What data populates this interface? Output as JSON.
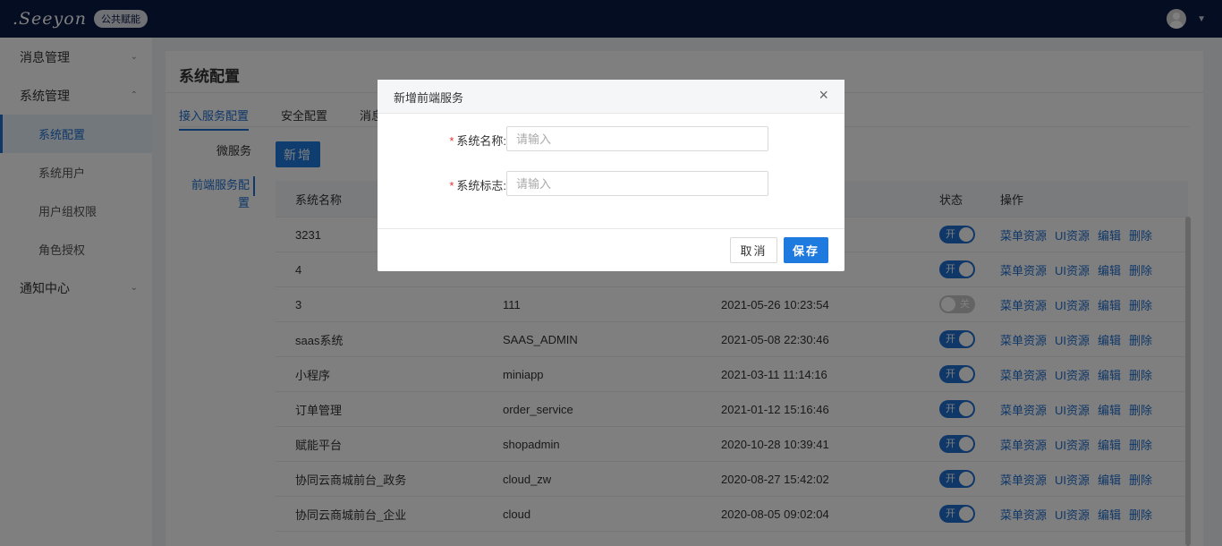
{
  "topbar": {
    "logo": ".Seeyon",
    "logo_tag": "公共赋能"
  },
  "sidebar": {
    "groups": [
      {
        "label": "消息管理"
      },
      {
        "label": "系统管理"
      },
      {
        "label": "通知中心"
      }
    ],
    "items": [
      {
        "label": "系统配置"
      },
      {
        "label": "系统用户"
      },
      {
        "label": "用户组权限"
      },
      {
        "label": "角色授权"
      }
    ]
  },
  "page": {
    "title": "系统配置",
    "tabs": [
      "接入服务配置",
      "安全配置",
      "消息"
    ],
    "subnav": [
      "微服务",
      "前端服务配置"
    ],
    "add_button": "新增"
  },
  "table": {
    "headers": [
      "系统名称",
      "状态",
      "操作"
    ],
    "ops": [
      "菜单资源",
      "UI资源",
      "编辑",
      "删除"
    ],
    "status_on": "开",
    "status_off": "关",
    "rows": [
      {
        "name": "3231",
        "flag": "",
        "time": "",
        "status": "on"
      },
      {
        "name": "4",
        "flag": "",
        "time": "",
        "status": "on"
      },
      {
        "name": "3",
        "flag": "111",
        "time": "2021-05-26 10:23:54",
        "status": "off"
      },
      {
        "name": "saas系统",
        "flag": "SAAS_ADMIN",
        "time": "2021-05-08 22:30:46",
        "status": "on"
      },
      {
        "name": "小程序",
        "flag": "miniapp",
        "time": "2021-03-11 11:14:16",
        "status": "on"
      },
      {
        "name": "订单管理",
        "flag": "order_service",
        "time": "2021-01-12 15:16:46",
        "status": "on"
      },
      {
        "name": "赋能平台",
        "flag": "shopadmin",
        "time": "2020-10-28 10:39:41",
        "status": "on"
      },
      {
        "name": "协同云商城前台_政务",
        "flag": "cloud_zw",
        "time": "2020-08-27 15:42:02",
        "status": "on"
      },
      {
        "name": "协同云商城前台_企业",
        "flag": "cloud",
        "time": "2020-08-05 09:02:04",
        "status": "on"
      }
    ]
  },
  "modal": {
    "title": "新增前端服务",
    "close": "×",
    "fields": [
      {
        "label": "系统名称:",
        "placeholder": "请输入",
        "value": ""
      },
      {
        "label": "系统标志:",
        "placeholder": "请输入",
        "value": ""
      }
    ],
    "cancel_label": "取消",
    "save_label": "保存"
  }
}
